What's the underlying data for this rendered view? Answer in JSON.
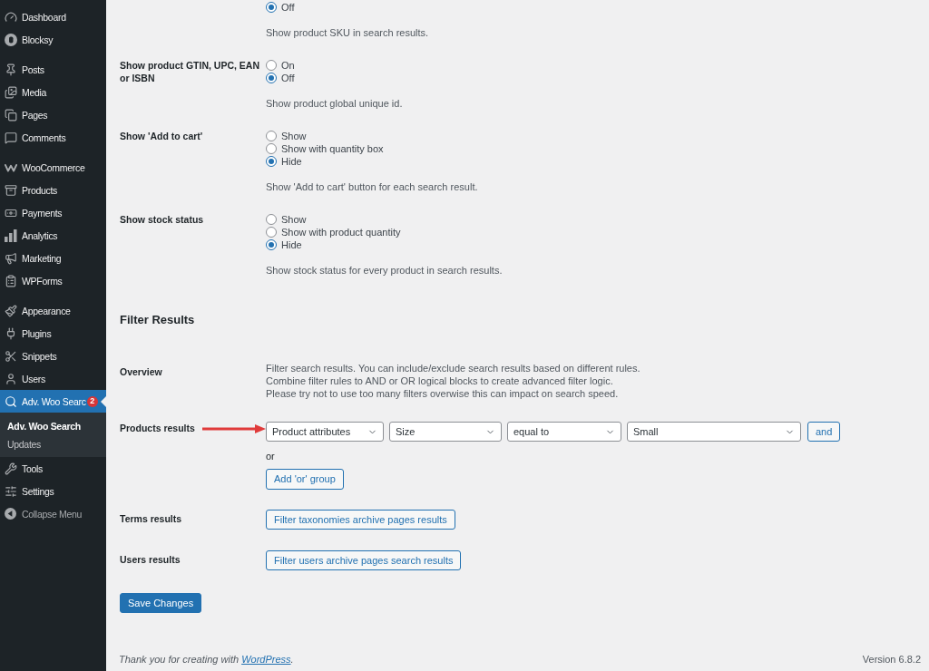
{
  "sidebar": {
    "groups": [
      [
        {
          "label": "Dashboard",
          "selected": false
        },
        {
          "label": "Blocksy",
          "selected": false
        }
      ],
      [
        {
          "label": "Posts",
          "selected": false
        },
        {
          "label": "Media",
          "selected": false
        },
        {
          "label": "Pages",
          "selected": false
        },
        {
          "label": "Comments",
          "selected": false
        }
      ],
      [
        {
          "label": "WooCommerce",
          "selected": false
        },
        {
          "label": "Products",
          "selected": false
        },
        {
          "label": "Payments",
          "selected": false
        },
        {
          "label": "Analytics",
          "selected": false
        },
        {
          "label": "Marketing",
          "selected": false
        },
        {
          "label": "WPForms",
          "selected": false
        }
      ],
      [
        {
          "label": "Appearance",
          "selected": false
        },
        {
          "label": "Plugins",
          "selected": false
        },
        {
          "label": "Snippets",
          "selected": false
        },
        {
          "label": "Users",
          "selected": false
        },
        {
          "label": "Adv. Woo Searc",
          "selected": true,
          "badge": "2",
          "submenu": [
            {
              "label": "Adv. Woo Search",
              "selected": true
            },
            {
              "label": "Updates",
              "selected": false
            }
          ]
        },
        {
          "label": "Tools",
          "selected": false
        },
        {
          "label": "Settings",
          "selected": false
        }
      ]
    ],
    "collapse": {
      "label": "Collapse Menu"
    }
  },
  "settings": [
    {
      "options": [
        {
          "label": "Off",
          "selected": true
        }
      ],
      "description": "Show product SKU in search results."
    },
    {
      "label": "Show product GTIN, UPC, EAN or ISBN",
      "options": [
        {
          "label": "On",
          "selected": false
        },
        {
          "label": "Off",
          "selected": true
        }
      ],
      "description": "Show product global unique id."
    },
    {
      "label": "Show 'Add to cart'",
      "options": [
        {
          "label": "Show",
          "selected": false
        },
        {
          "label": "Show with quantity box",
          "selected": false
        },
        {
          "label": "Hide",
          "selected": true
        }
      ],
      "description": "Show 'Add to cart' button for each search result."
    },
    {
      "label": "Show stock status",
      "options": [
        {
          "label": "Show",
          "selected": false
        },
        {
          "label": "Show with product quantity",
          "selected": false
        },
        {
          "label": "Hide",
          "selected": true
        }
      ],
      "description": "Show stock status for every product in search results."
    }
  ],
  "filter_results": {
    "heading": "Filter Results",
    "overview": {
      "label": "Overview",
      "lines": [
        "Filter search results. You can include/exclude search results based on different rules.",
        "Combine filter rules to AND or OR logical blocks to create advanced filter logic.",
        "Please try not to use too many filters overwise this can impact on search speed."
      ]
    },
    "products_results": {
      "label": "Products results",
      "conditions": [
        {
          "value": "Product attributes"
        },
        {
          "value": "Size"
        },
        {
          "value": "equal to"
        },
        {
          "value": "Small"
        }
      ],
      "and_button": "and",
      "or_label": "or",
      "add_group_button": "Add 'or' group"
    },
    "terms_results": {
      "label": "Terms results",
      "button": "Filter taxonomies archive pages results"
    },
    "users_results": {
      "label": "Users results",
      "button": "Filter users archive pages search results"
    }
  },
  "save_button": "Save Changes",
  "footer": {
    "text": "Thank you for creating with ",
    "link": "WordPress",
    "after": ".",
    "version": "Version 6.8.2"
  }
}
